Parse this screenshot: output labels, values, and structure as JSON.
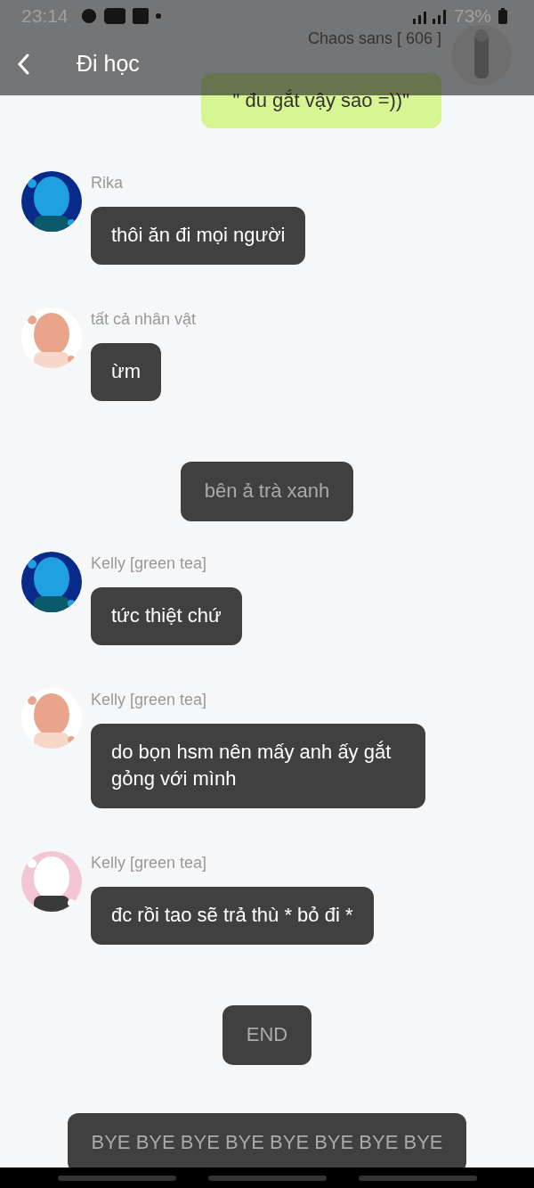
{
  "status_bar": {
    "time": "23:14",
    "battery": "73%"
  },
  "header": {
    "title": "Đi học"
  },
  "messages": [
    {
      "kind": "right",
      "name": "Chaos sans [ 606 ]",
      "text": "\" đu gắt vậy sao =))\""
    },
    {
      "kind": "left",
      "name": "Rika",
      "text": "thôi ăn đi mọi người"
    },
    {
      "kind": "left",
      "name": "tất cả nhân vật",
      "text": "ừm"
    },
    {
      "kind": "narration",
      "text": "bên ả trà xanh"
    },
    {
      "kind": "left",
      "name": "Kelly [green tea]",
      "text": "tức thiệt chứ"
    },
    {
      "kind": "left",
      "name": "Kelly [green tea]",
      "text": "do bọn hsm nên mấy anh ấy gắt gỏng với mình"
    },
    {
      "kind": "left",
      "name": "Kelly [green tea]",
      "text": "đc rồi tao sẽ trả thù * bỏ đi *"
    },
    {
      "kind": "narration",
      "text": "END"
    },
    {
      "kind": "narration",
      "text": "BYE BYE BYE BYE BYE BYE BYE BYE"
    }
  ]
}
